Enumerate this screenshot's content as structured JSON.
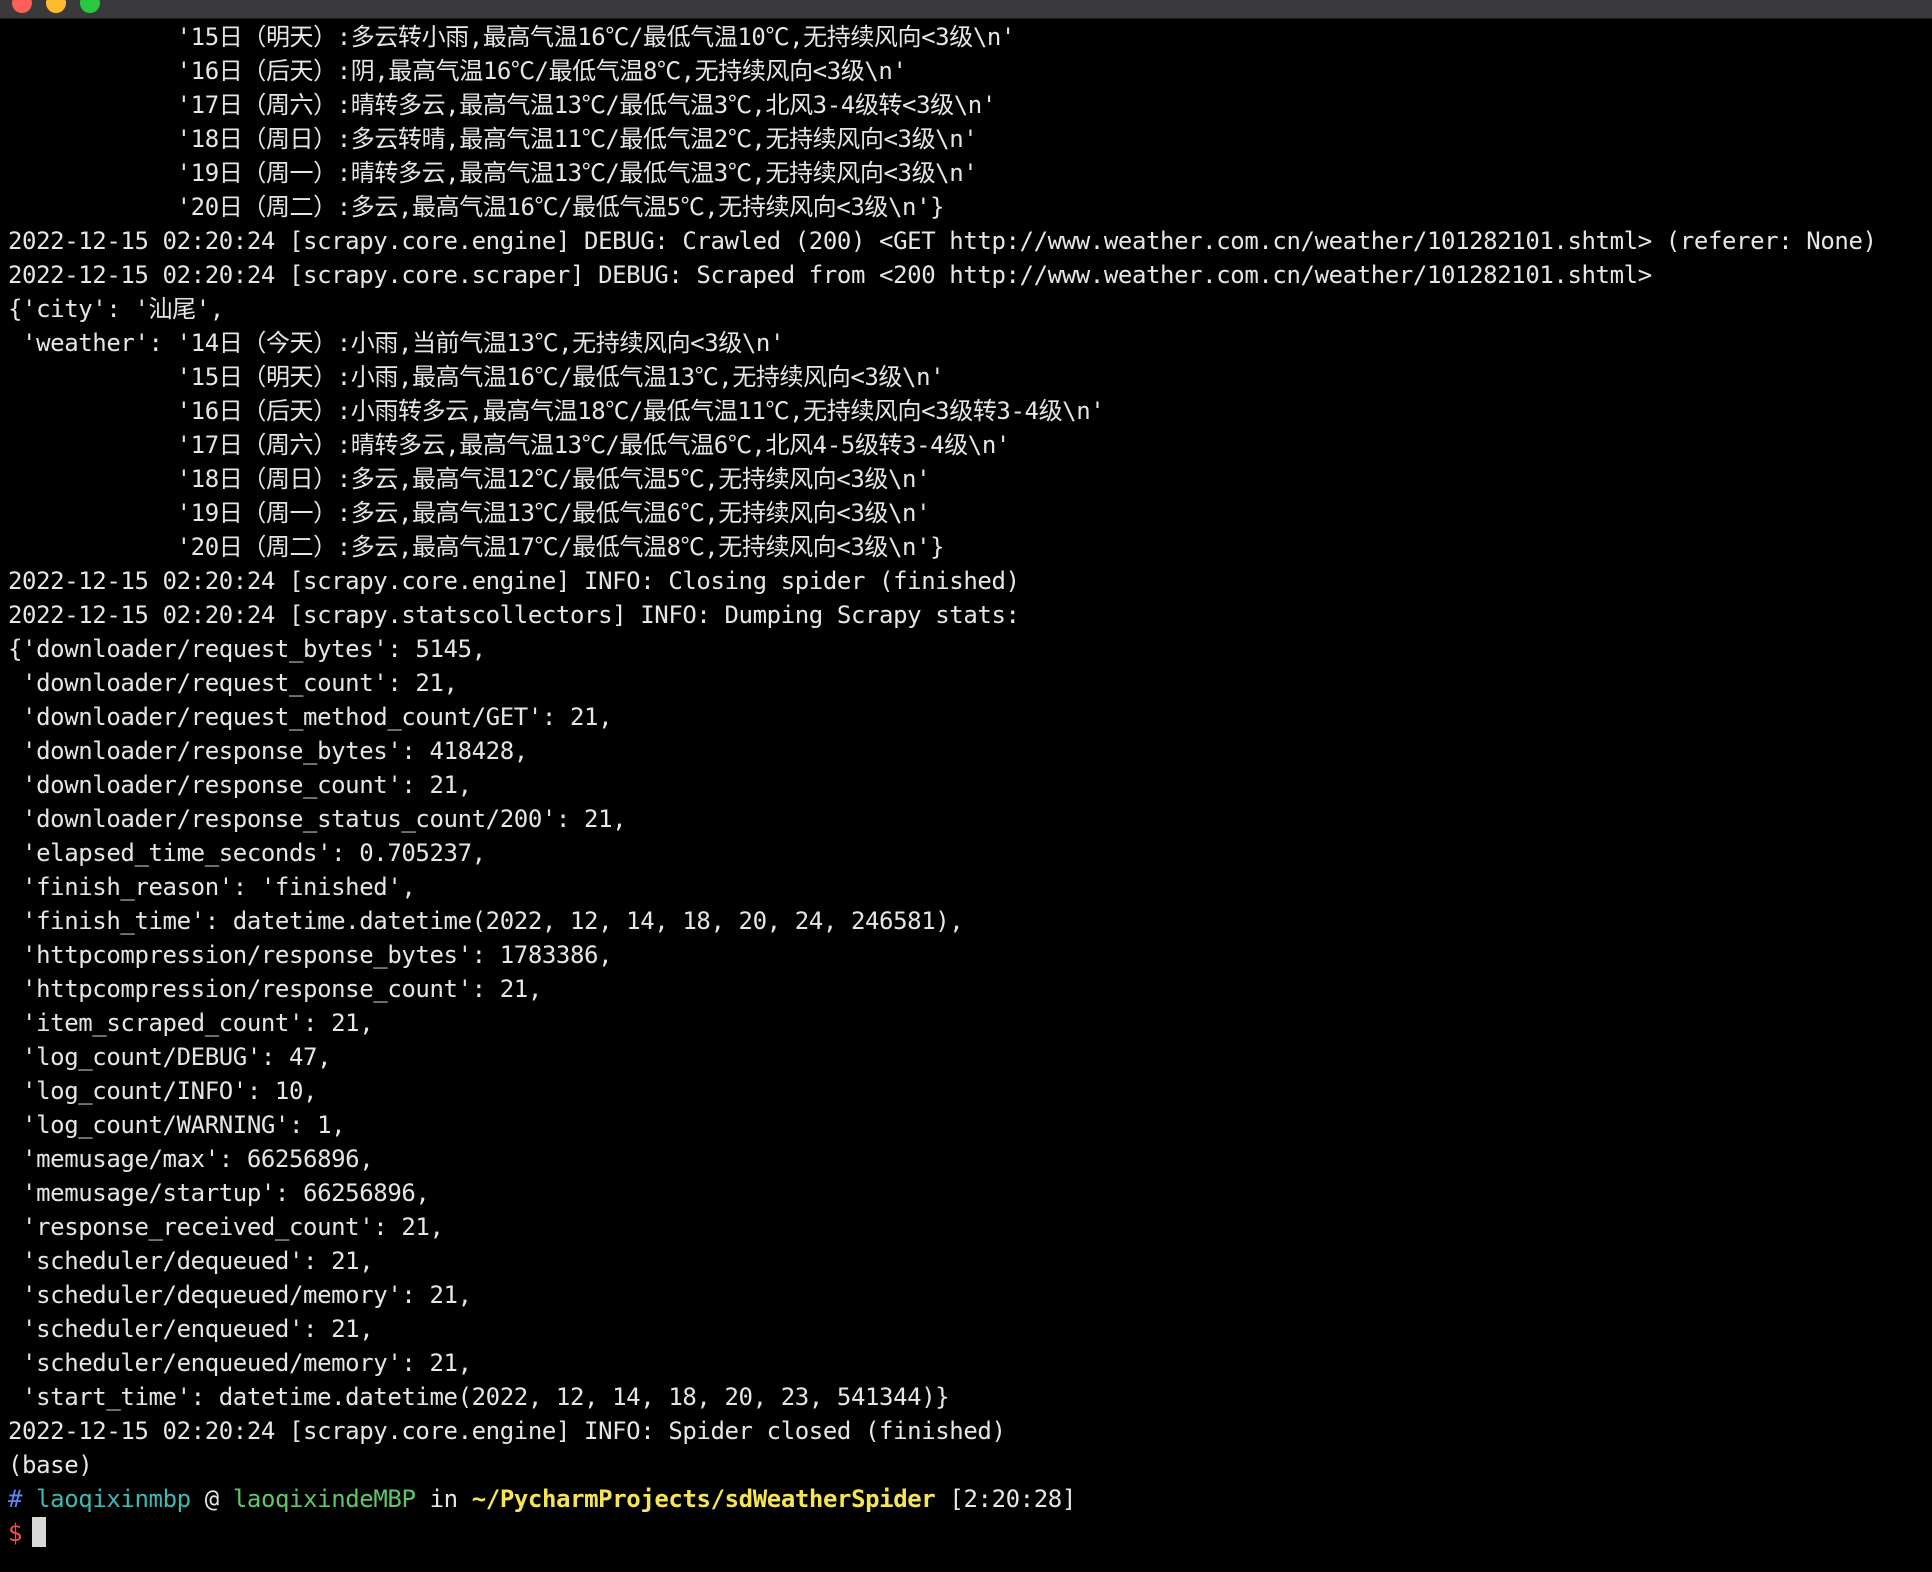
{
  "terminal": {
    "lines": [
      "            '15日（明天）:多云转小雨,最高气温16℃/最低气温10℃,无持续风向<3级\\n'",
      "            '16日（后天）:阴,最高气温16℃/最低气温8℃,无持续风向<3级\\n'",
      "            '17日（周六）:晴转多云,最高气温13℃/最低气温3℃,北风3-4级转<3级\\n'",
      "            '18日（周日）:多云转晴,最高气温11℃/最低气温2℃,无持续风向<3级\\n'",
      "            '19日（周一）:晴转多云,最高气温13℃/最低气温3℃,无持续风向<3级\\n'",
      "            '20日（周二）:多云,最高气温16℃/最低气温5℃,无持续风向<3级\\n'}",
      "2022-12-15 02:20:24 [scrapy.core.engine] DEBUG: Crawled (200) <GET http://www.weather.com.cn/weather/101282101.shtml> (referer: None)",
      "2022-12-15 02:20:24 [scrapy.core.scraper] DEBUG: Scraped from <200 http://www.weather.com.cn/weather/101282101.shtml>",
      "{'city': '汕尾',",
      " 'weather': '14日（今天）:小雨,当前气温13℃,无持续风向<3级\\n'",
      "            '15日（明天）:小雨,最高气温16℃/最低气温13℃,无持续风向<3级\\n'",
      "            '16日（后天）:小雨转多云,最高气温18℃/最低气温11℃,无持续风向<3级转3-4级\\n'",
      "            '17日（周六）:晴转多云,最高气温13℃/最低气温6℃,北风4-5级转3-4级\\n'",
      "            '18日（周日）:多云,最高气温12℃/最低气温5℃,无持续风向<3级\\n'",
      "            '19日（周一）:多云,最高气温13℃/最低气温6℃,无持续风向<3级\\n'",
      "            '20日（周二）:多云,最高气温17℃/最低气温8℃,无持续风向<3级\\n'}",
      "2022-12-15 02:20:24 [scrapy.core.engine] INFO: Closing spider (finished)",
      "2022-12-15 02:20:24 [scrapy.statscollectors] INFO: Dumping Scrapy stats:",
      "{'downloader/request_bytes': 5145,",
      " 'downloader/request_count': 21,",
      " 'downloader/request_method_count/GET': 21,",
      " 'downloader/response_bytes': 418428,",
      " 'downloader/response_count': 21,",
      " 'downloader/response_status_count/200': 21,",
      " 'elapsed_time_seconds': 0.705237,",
      " 'finish_reason': 'finished',",
      " 'finish_time': datetime.datetime(2022, 12, 14, 18, 20, 24, 246581),",
      " 'httpcompression/response_bytes': 1783386,",
      " 'httpcompression/response_count': 21,",
      " 'item_scraped_count': 21,",
      " 'log_count/DEBUG': 47,",
      " 'log_count/INFO': 10,",
      " 'log_count/WARNING': 1,",
      " 'memusage/max': 66256896,",
      " 'memusage/startup': 66256896,",
      " 'response_received_count': 21,",
      " 'scheduler/dequeued': 21,",
      " 'scheduler/dequeued/memory': 21,",
      " 'scheduler/enqueued': 21,",
      " 'scheduler/enqueued/memory': 21,",
      " 'start_time': datetime.datetime(2022, 12, 14, 18, 20, 23, 541344)}",
      "2022-12-15 02:20:24 [scrapy.core.engine] INFO: Spider closed (finished)",
      "(base)"
    ],
    "prompt": {
      "hash": "#",
      "user": "laoqixinmbp",
      "at": "@",
      "host": "laoqixindeMBP",
      "in": "in",
      "path": "~/PycharmProjects/sdWeatherSpider",
      "time": "[2:20:28]",
      "dollar": "$"
    }
  },
  "colors": {
    "background": "#000000",
    "text": "#e6e6e6",
    "prompt_hash": "#5f87ff",
    "prompt_user": "#3fb8b0",
    "prompt_host": "#5fc76a",
    "prompt_path": "#f5e556",
    "prompt_dollar": "#ff4a4a"
  }
}
